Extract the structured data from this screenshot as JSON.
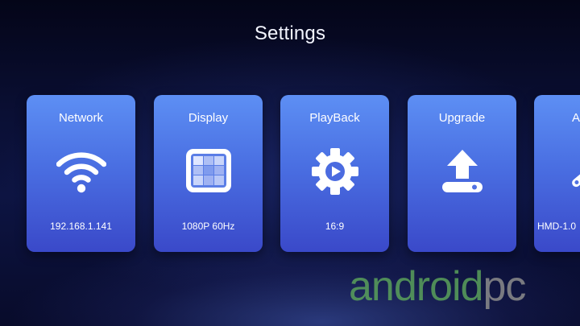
{
  "header": {
    "title": "Settings"
  },
  "cards": [
    {
      "title": "Network",
      "value": "192.168.1.141",
      "icon": "wifi-icon"
    },
    {
      "title": "Display",
      "value": "1080P 60Hz",
      "icon": "display-grid-icon"
    },
    {
      "title": "PlayBack",
      "value": "16:9",
      "icon": "gear-play-icon"
    },
    {
      "title": "Upgrade",
      "value": "",
      "icon": "upload-arrow-icon"
    },
    {
      "title": "A",
      "value": "HMD-1.0",
      "icon": "wrench-icon"
    }
  ],
  "watermark": {
    "main": "android",
    "tail": "pc"
  },
  "colors": {
    "card_top": "#5d8ff4",
    "card_bottom": "#3a49c9",
    "background": "#0a0f34",
    "watermark_green": "#5aa15b",
    "watermark_gray": "#8c8c8c"
  }
}
